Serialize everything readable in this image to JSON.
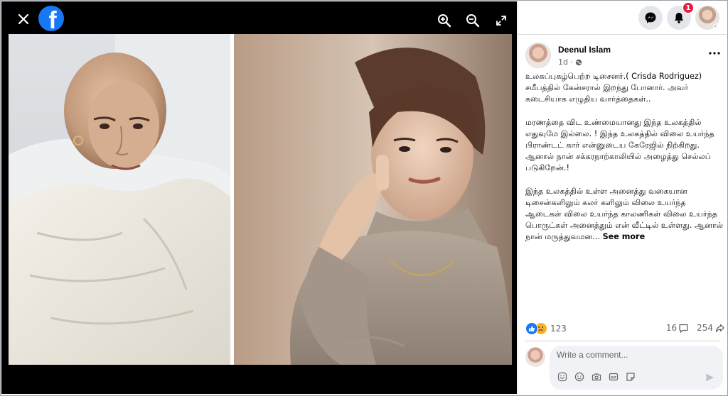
{
  "viewer": {
    "close_icon": "close-icon",
    "logo_icon": "facebook-logo",
    "logo_letter": "f",
    "zoom_in_icon": "zoom-in-icon",
    "zoom_out_icon": "zoom-out-icon",
    "fullscreen_icon": "fullscreen-icon",
    "background": "#000000"
  },
  "header": {
    "messenger_icon": "messenger-icon",
    "notifications_icon": "bell-icon",
    "notifications_badge": "1",
    "profile_icon": "avatar"
  },
  "post": {
    "author": "Deenul Islam",
    "time": "1d ·",
    "audience_icon": "globe-icon",
    "more_icon": "more-horizontal-icon",
    "paragraphs": [
      "உலகப்புகழ்பெற்ற டிசைனர்.( Crisda Rodriguez) சமீபத்தில் கேன்சரால் இறந்து போனார். அவர் கடைசியாக எழுதிய வார்த்தைகள்..",
      "மரணத்தை விட உண்மையானது இந்த உலகத்தில் எதுவுமே இல்லை. ! இந்த உலகத்தில் விலை உயர்ந்த பிராண்டட் கார் என்னுடைய கேரேஜில் நிற்கிறது. ஆனால் நான் சக்கரநாற்காலியில் அழைத்து செல்லப் படுகிறேன்.!",
      "இந்த உலகத்தில் உள்ள அனைத்து வகையான டிசைன்களிலும் கலர் களிலும் விலை உயர்ந்த ஆடைகள் விலை உயர்ந்த காலணிகள் விலை உயர்ந்த பொருட்கள் அனைத்தும் என் வீட்டில் உள்ளது. ஆனால் நான் மருத்துவமன..."
    ],
    "see_more": "See more"
  },
  "stats": {
    "reaction_icons": [
      "like-icon",
      "sad-icon"
    ],
    "reactions_count": "123",
    "comments_count": "16",
    "comment_icon": "comment-icon",
    "shares_count": "254",
    "share_icon": "share-icon"
  },
  "comment": {
    "placeholder": "Write a comment...",
    "tool_icons": [
      "sticker-icon",
      "emoji-icon",
      "camera-icon",
      "gif-icon",
      "sticker-face-icon"
    ],
    "send_icon": "send-icon"
  },
  "colors": {
    "brand": "#1877f2",
    "badge": "#e41e3f",
    "secondary_text": "#65676b",
    "button_bg": "#e4e6eb",
    "input_bg": "#f0f2f5"
  }
}
